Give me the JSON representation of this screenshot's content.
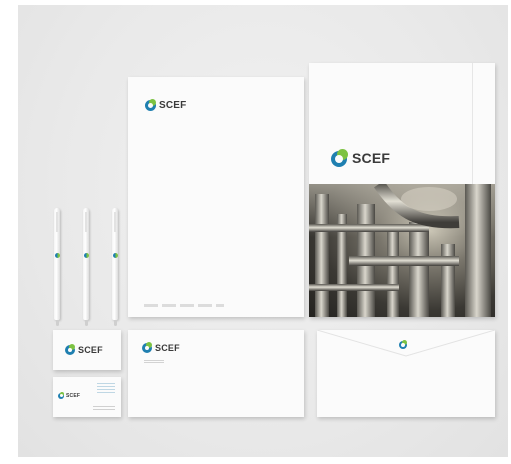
{
  "brand": {
    "name": "SCEF",
    "colors": {
      "blue": "#1f7fb0",
      "green": "#7cc242",
      "text": "#3a3a3a",
      "paper": "#fbfbfb"
    }
  },
  "scene": {
    "items": [
      "letterhead",
      "folder",
      "pens",
      "business-card-front",
      "business-card-back",
      "compliment-slip",
      "envelope"
    ]
  }
}
